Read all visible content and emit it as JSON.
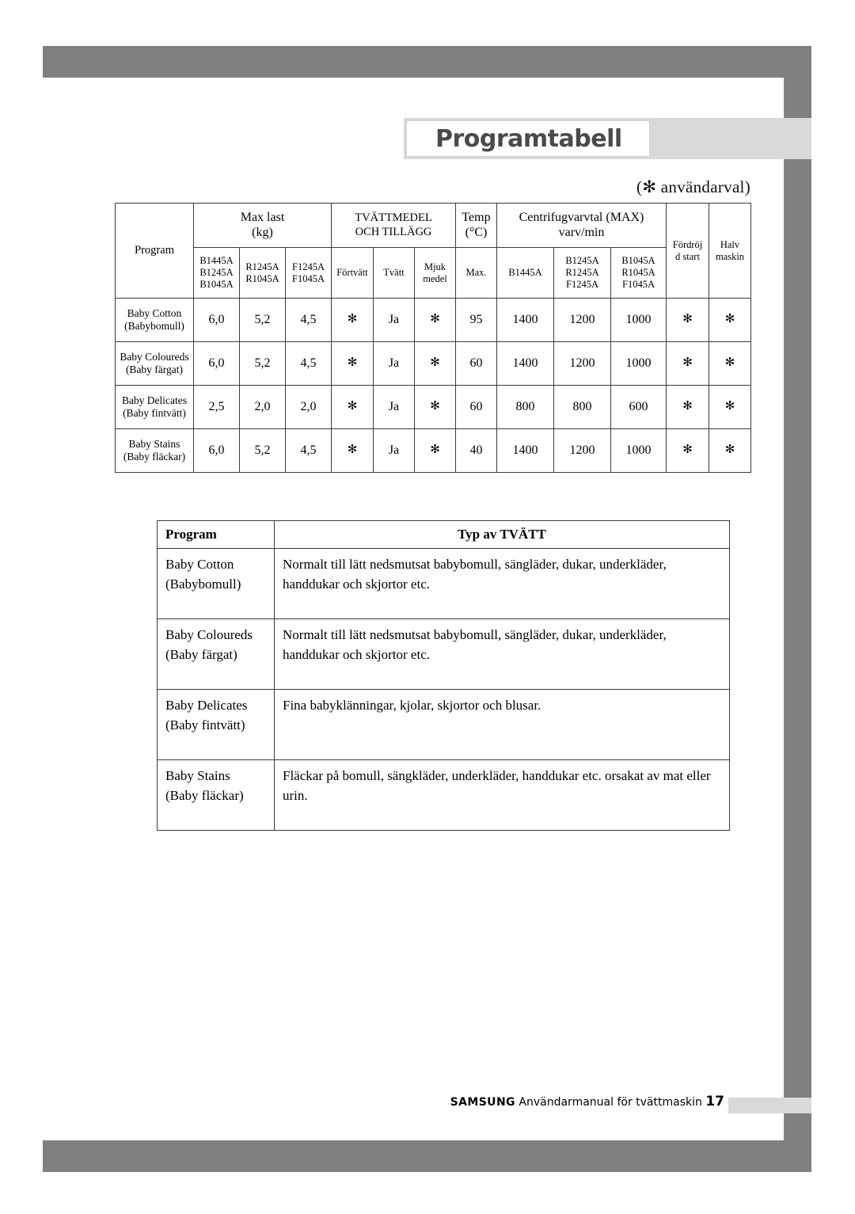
{
  "title": "Programtabell",
  "user_choice_note": "(✻ användarval)",
  "asterisk": "✻",
  "program_table": {
    "headers": {
      "program": "Program",
      "max_load": "Max last",
      "max_load_unit": "(kg)",
      "detergent": "TVÄTTMEDEL",
      "detergent_2": "OCH TILLÄGG",
      "temp": "Temp",
      "temp_unit": "(°C)",
      "spin": "Centrifugvarvtal (MAX)",
      "spin_unit": "varv/min",
      "delay_start_1": "Fördröj",
      "delay_start_2": "d start",
      "half_load_1": "Halv",
      "half_load_2": "maskin"
    },
    "sub_headers": {
      "load_b_1": "B1445A",
      "load_b_2": "B1245A",
      "load_b_3": "B1045A",
      "load_r_1": "R1245A",
      "load_r_2": "R1045A",
      "load_f_1": "F1245A",
      "load_f_2": "F1045A",
      "prewash": "Förtvätt",
      "wash": "Tvätt",
      "softener_1": "Mjuk",
      "softener_2": "medel",
      "temp_max": "Max.",
      "spin_b1445": "B1445A",
      "spin_mid_1": "B1245A",
      "spin_mid_2": "R1245A",
      "spin_mid_3": "F1245A",
      "spin_low_1": "B1045A",
      "spin_low_2": "R1045A",
      "spin_low_3": "F1045A"
    },
    "rows": [
      {
        "program_en": "Baby Cotton",
        "program_sv": "(Babybomull)",
        "load_b": "6,0",
        "load_r": "5,2",
        "load_f": "4,5",
        "prewash": "✻",
        "wash": "Ja",
        "softener": "✻",
        "temp": "95",
        "spin_b1445": "1400",
        "spin_mid": "1200",
        "spin_low": "1000",
        "delay": "✻",
        "half": "✻"
      },
      {
        "program_en": "Baby Coloureds",
        "program_sv": "(Baby färgat)",
        "load_b": "6,0",
        "load_r": "5,2",
        "load_f": "4,5",
        "prewash": "✻",
        "wash": "Ja",
        "softener": "✻",
        "temp": "60",
        "spin_b1445": "1400",
        "spin_mid": "1200",
        "spin_low": "1000",
        "delay": "✻",
        "half": "✻"
      },
      {
        "program_en": "Baby Delicates",
        "program_sv": "(Baby fintvätt)",
        "load_b": "2,5",
        "load_r": "2,0",
        "load_f": "2,0",
        "prewash": "✻",
        "wash": "Ja",
        "softener": "✻",
        "temp": "60",
        "spin_b1445": "800",
        "spin_mid": "800",
        "spin_low": "600",
        "delay": "✻",
        "half": "✻"
      },
      {
        "program_en": "Baby Stains",
        "program_sv": "(Baby fläckar)",
        "load_b": "6,0",
        "load_r": "5,2",
        "load_f": "4,5",
        "prewash": "✻",
        "wash": "Ja",
        "softener": "✻",
        "temp": "40",
        "spin_b1445": "1400",
        "spin_mid": "1200",
        "spin_low": "1000",
        "delay": "✻",
        "half": "✻"
      }
    ]
  },
  "description_table": {
    "header_program": "Program",
    "header_type": "Typ av TVÄTT",
    "rows": [
      {
        "program_en": "Baby Cotton",
        "program_sv": "(Babybomull)",
        "description": "Normalt till lätt nedsmutsat babybomull, sängläder, dukar, underkläder, handdukar och skjortor etc."
      },
      {
        "program_en": "Baby Coloureds",
        "program_sv": "(Baby färgat)",
        "description": "Normalt till lätt nedsmutsat babybomull, sängläder, dukar, underkläder, handdukar och skjortor etc."
      },
      {
        "program_en": "Baby Delicates",
        "program_sv": "(Baby fintvätt)",
        "description": "Fina babyklänningar, kjolar, skjortor och blusar."
      },
      {
        "program_en": "Baby Stains",
        "program_sv": "(Baby fläckar)",
        "description": "Fläckar på bomull, sängkläder, underkläder, handdukar etc. orsakat av mat eller urin."
      }
    ]
  },
  "footer": {
    "brand": "SAMSUNG",
    "manual": "Användarmanual för tvättmaskin",
    "page": "17"
  },
  "colors": {
    "frame_gray": "#808080",
    "band_gray": "#d9d9d9",
    "title_text": "#4a4a4a"
  }
}
